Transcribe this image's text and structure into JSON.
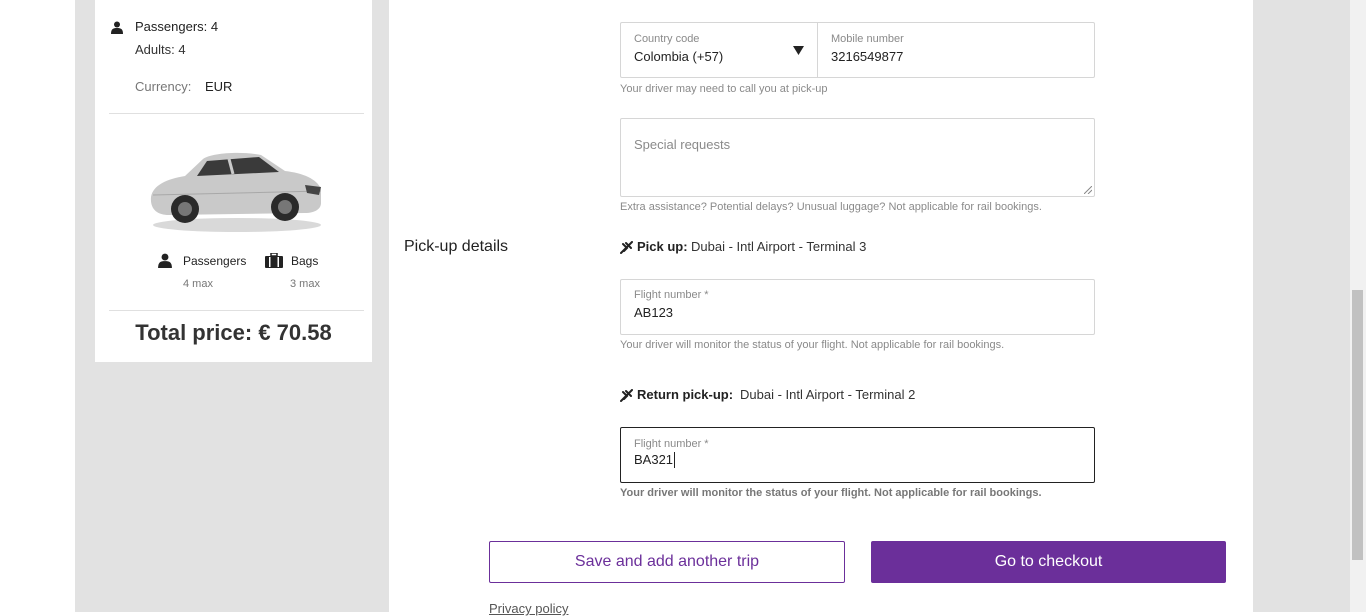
{
  "summary": {
    "passengers_label": "Passengers: 4",
    "adults_label": "Adults: 4",
    "currency_label": "Currency:",
    "currency_value": "EUR",
    "vehicle": {
      "passengers_label": "Passengers",
      "passengers_max": "4 max",
      "bags_label": "Bags",
      "bags_max": "3 max"
    },
    "total_price": "Total price: € 70.58"
  },
  "contact": {
    "country_code_label": "Country code",
    "country_code_value": "Colombia (+57)",
    "mobile_label": "Mobile number",
    "mobile_value": "3216549877",
    "mobile_hint": "Your driver may need to call you at pick-up",
    "special_requests_placeholder": "Special requests",
    "special_requests_hint": "Extra assistance? Potential delays? Unusual luggage? Not applicable for rail bookings."
  },
  "pickup": {
    "section_title": "Pick-up details",
    "pickup_label": "Pick up:",
    "pickup_location": "Dubai - Intl Airport - Terminal 3",
    "flight_label": "Flight number *",
    "flight_value": "AB123",
    "flight_hint": "Your driver will monitor the status of your flight. Not applicable for rail bookings.",
    "return_label": "Return pick-up:",
    "return_location": "Dubai - Intl Airport - Terminal 2",
    "return_flight_label": "Flight number *",
    "return_flight_value": "BA321",
    "return_flight_hint": "Your driver will monitor the status of your flight. Not applicable for rail bookings."
  },
  "actions": {
    "save_label": "Save and add another trip",
    "checkout_label": "Go to checkout",
    "privacy_label": "Privacy policy"
  },
  "colors": {
    "accent": "#6b2f9a",
    "background": "#e2e2e2"
  },
  "icons": [
    "person-icon",
    "luggage-icon",
    "plane-icon",
    "dropdown-caret-icon"
  ]
}
